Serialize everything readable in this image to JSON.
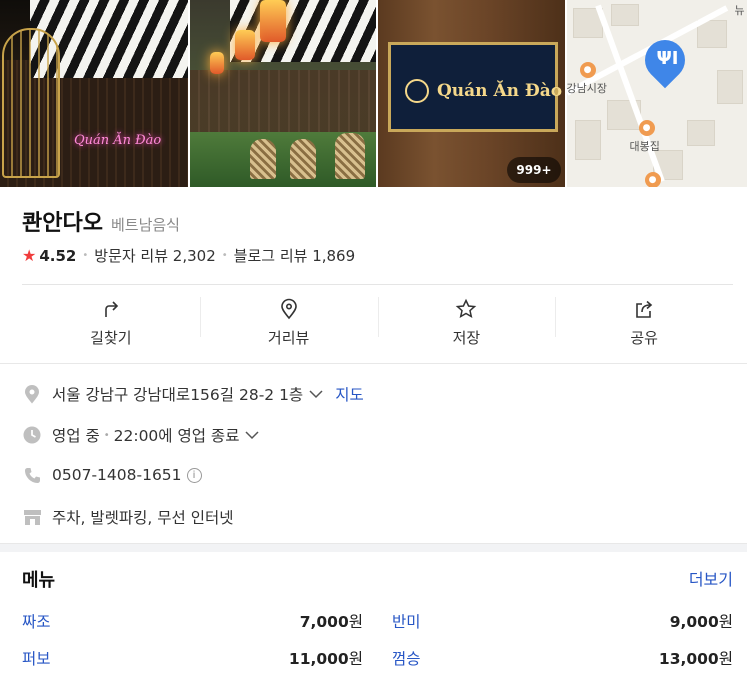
{
  "photos": {
    "photo1_sign": "Quán Ăn Đào",
    "photo3_sign": "Quán Ăn Đào",
    "photo_count": "999+",
    "map_labels": {
      "market": "강남시장",
      "restaurant": "대봉집",
      "corner": "뉴"
    }
  },
  "place": {
    "name": "콴안다오",
    "category": "베트남음식",
    "rating": "4.52",
    "visitor_reviews": "방문자 리뷰 2,302",
    "blog_reviews": "블로그 리뷰 1,869"
  },
  "actions": [
    {
      "label": "길찾기",
      "icon": "directions-icon"
    },
    {
      "label": "거리뷰",
      "icon": "street-view-icon"
    },
    {
      "label": "저장",
      "icon": "star-icon"
    },
    {
      "label": "공유",
      "icon": "share-icon"
    }
  ],
  "info": {
    "address": "서울 강남구 강남대로156길 28-2 1층",
    "map_link": "지도",
    "status": "영업 중",
    "hours": "22:00에 영업 종료",
    "phone": "0507-1408-1651",
    "info_mark": "i",
    "amenities": "주차, 발렛파킹, 무선 인터넷"
  },
  "menu": {
    "title": "메뉴",
    "more": "더보기",
    "currency": "원",
    "items": [
      {
        "name": "짜조",
        "price": "7,000"
      },
      {
        "name": "반미",
        "price": "9,000"
      },
      {
        "name": "퍼보",
        "price": "11,000"
      },
      {
        "name": "껌승",
        "price": "13,000"
      }
    ]
  },
  "colors": {
    "accent_blue": "#2756c5",
    "star_red": "#f03c3c",
    "pin_blue": "#3f86e8"
  }
}
